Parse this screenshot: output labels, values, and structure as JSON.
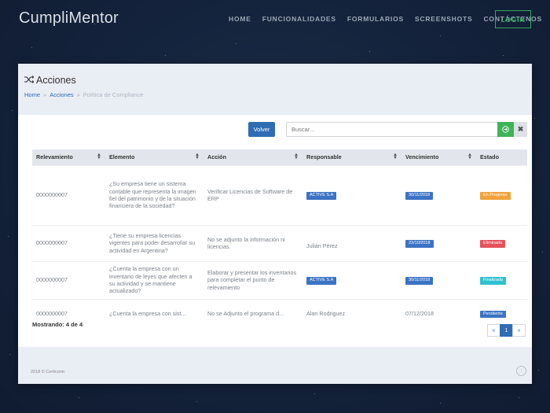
{
  "brand": "CumpliMentor",
  "nav": {
    "items": [
      "HOME",
      "FUNCIONALIDADES",
      "FORMULARIOS",
      "SCREENSHOTS",
      "CONTÁCTENOS"
    ],
    "login": "LOGIN"
  },
  "page": {
    "title": "Acciones",
    "breadcrumb": [
      "Home",
      "Acciones",
      "Política de Compliance"
    ]
  },
  "toolbar": {
    "volver_label": "Volver",
    "search_placeholder": "Buscar..."
  },
  "table": {
    "columns": [
      "Relevamiento",
      "Elemento",
      "Acción",
      "Responsable",
      "Vencimiento",
      "Estado"
    ],
    "rows": [
      {
        "relevamiento": "0000000007",
        "elemento": "¿Su empresa tiene un sistema contable que representa la imagen fiel del patrimonio y de la situación financiera de la sociedad?",
        "accion": "Verificar Licencias de Software de ERP",
        "responsable": "ACTIVE S.A",
        "responsable_badge": true,
        "vencimiento": "30/11/2018",
        "vencimiento_badge": true,
        "estado": "En Progreso",
        "estado_color": "#f0a23b"
      },
      {
        "relevamiento": "0000000007",
        "elemento": "¿Tiene su empresa licencias vigentes para poder desarrollar su actividad en Argentina?",
        "accion": "No se adjunto la información ni licencias.",
        "responsable": "Julián Pérez",
        "responsable_badge": false,
        "vencimiento": "23/10/2018",
        "vencimiento_badge": true,
        "estado": "Eliminada",
        "estado_color": "#e5525b"
      },
      {
        "relevamiento": "0000000007",
        "elemento": "¿Cuenta la empresa con un inventario de leyes que afecten a su actividad y se mantiene actualizado?",
        "accion": "Elaborar y presentar los inventarios para completar el punto de relevamiento",
        "responsable": "ACTIVE S.A",
        "responsable_badge": true,
        "vencimiento": "30/11/2018",
        "vencimiento_badge": true,
        "estado": "Finalizada",
        "estado_color": "#2fc2d0"
      },
      {
        "relevamiento": "0000000007",
        "elemento": "¿Cuenta la empresa con sist...",
        "accion": "No se Adjunto el programa d...",
        "responsable": "Alan Rodriguez",
        "responsable_badge": false,
        "vencimiento": "07/12/2018",
        "vencimiento_badge": false,
        "estado": "Pendiente",
        "estado_color": "#3c73c4"
      }
    ]
  },
  "summary": "Mostrando: 4 de 4",
  "pagination": {
    "prev": "«",
    "current": "1",
    "next": "»"
  },
  "footer": {
    "copyright": "2018 © Certiconic"
  },
  "colors": {
    "primary": "#2f6db5",
    "success": "#3fb35a",
    "badge_blue": "#3c73c4"
  }
}
